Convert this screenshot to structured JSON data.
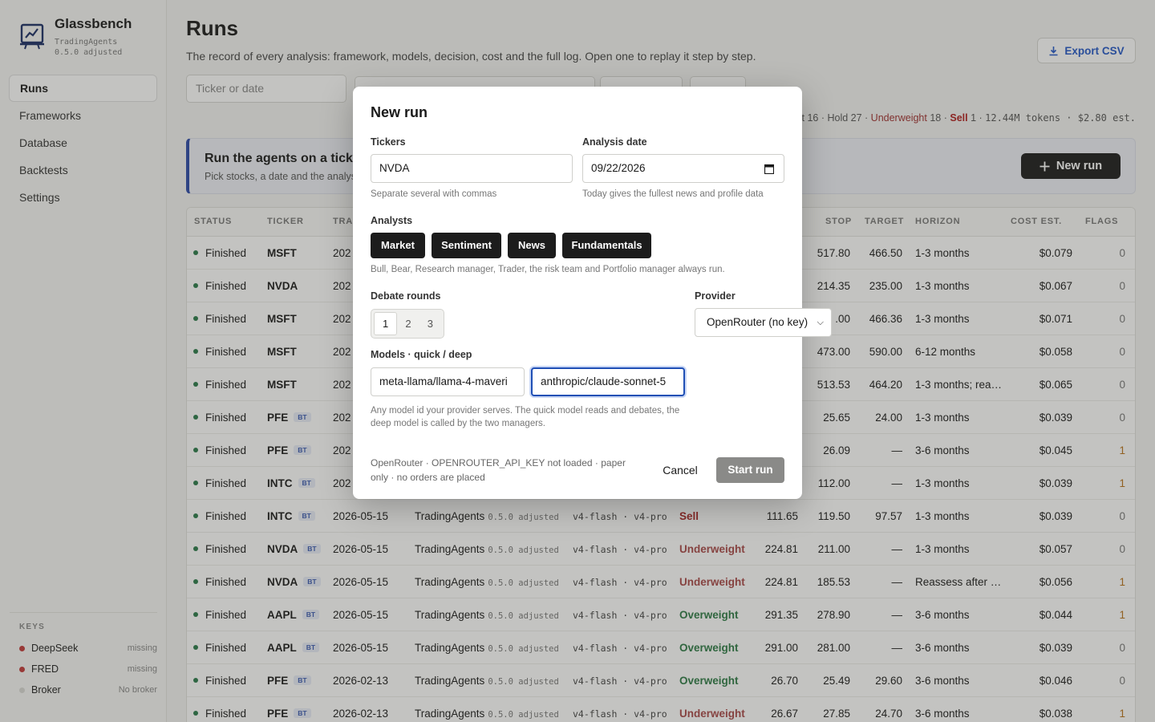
{
  "brand": {
    "name": "Glassbench",
    "sub1": "TradingAgents",
    "sub2": "0.5.0 adjusted"
  },
  "nav": {
    "items": [
      {
        "label": "Runs",
        "active": true
      },
      {
        "label": "Frameworks"
      },
      {
        "label": "Database"
      },
      {
        "label": "Backtests"
      },
      {
        "label": "Settings"
      }
    ]
  },
  "keys": {
    "title": "KEYS",
    "items": [
      {
        "label": "DeepSeek",
        "status": "missing",
        "color": "#c23a3a"
      },
      {
        "label": "FRED",
        "status": "missing",
        "color": "#c23a3a"
      },
      {
        "label": "Broker",
        "status": "No broker",
        "color": "#d8d8d4"
      }
    ]
  },
  "header": {
    "title": "Runs",
    "description": "The record of every analysis: framework, models, decision, cost and the full log. Open one to replay it step by step.",
    "export_label": "Export CSV"
  },
  "filters": {
    "ticker_placeholder": "Ticker or date"
  },
  "summary": {
    "pre": "ht 16 · Hold 27 · ",
    "underweight": "Underweight",
    "uw_count": " 18 · ",
    "sell": "Sell",
    "post": " 1 · ",
    "tokens": "12.44M tokens",
    "cost": " · $2.80 est."
  },
  "banner": {
    "title": "Run the agents on a ticker",
    "subtitle": "Pick stocks, a date and the analysts",
    "button_label": "New run"
  },
  "table": {
    "headers": {
      "status": "STATUS",
      "ticker": "TICKER",
      "trade": "TRA",
      "stop": "STOP",
      "target": "TARGET",
      "horizon": "HORIZON",
      "cost": "COST EST.",
      "flags": "FLAGS"
    },
    "rows": [
      {
        "status": "Finished",
        "ticker": "MSFT",
        "bt": false,
        "date": "202",
        "framework": "",
        "version": "",
        "models": "",
        "decision": "",
        "entry": "",
        "stop": "517.80",
        "target": "466.50",
        "horizon": "1-3 months",
        "cost": "$0.079",
        "flags": "0"
      },
      {
        "status": "Finished",
        "ticker": "NVDA",
        "bt": false,
        "date": "202",
        "framework": "",
        "version": "",
        "models": "",
        "decision": "",
        "entry": "",
        "stop": "214.35",
        "target": "235.00",
        "horizon": "1-3 months",
        "cost": "$0.067",
        "flags": "0"
      },
      {
        "status": "Finished",
        "ticker": "MSFT",
        "bt": false,
        "date": "202",
        "framework": "",
        "version": "",
        "models": "",
        "decision": "",
        "entry": "",
        "stop": ".00",
        "target": "466.36",
        "horizon": "1-3 months",
        "cost": "$0.071",
        "flags": "0"
      },
      {
        "status": "Finished",
        "ticker": "MSFT",
        "bt": false,
        "date": "202",
        "framework": "",
        "version": "",
        "models": "",
        "decision": "",
        "entry": "",
        "stop": "473.00",
        "target": "590.00",
        "horizon": "6-12 months",
        "cost": "$0.058",
        "flags": "0"
      },
      {
        "status": "Finished",
        "ticker": "MSFT",
        "bt": false,
        "date": "202",
        "framework": "",
        "version": "",
        "models": "",
        "decision": "",
        "entry": "",
        "stop": "513.53",
        "target": "464.20",
        "horizon": "1-3 months; rea…",
        "cost": "$0.065",
        "flags": "0"
      },
      {
        "status": "Finished",
        "ticker": "PFE",
        "bt": true,
        "date": "202",
        "framework": "",
        "version": "",
        "models": "",
        "decision": "",
        "entry": "",
        "stop": "25.65",
        "target": "24.00",
        "horizon": "1-3 months",
        "cost": "$0.039",
        "flags": "0"
      },
      {
        "status": "Finished",
        "ticker": "PFE",
        "bt": true,
        "date": "202",
        "framework": "",
        "version": "",
        "models": "",
        "decision": "",
        "entry": "",
        "stop": "26.09",
        "target": "—",
        "horizon": "3-6 months",
        "cost": "$0.045",
        "flags": "1"
      },
      {
        "status": "Finished",
        "ticker": "INTC",
        "bt": true,
        "date": "202",
        "framework": "",
        "version": "",
        "models": "",
        "decision": "",
        "entry": "",
        "stop": "112.00",
        "target": "—",
        "horizon": "1-3 months",
        "cost": "$0.039",
        "flags": "1"
      },
      {
        "status": "Finished",
        "ticker": "INTC",
        "bt": true,
        "date": "2026-05-15",
        "framework": "TradingAgents",
        "version": "0.5.0 adjusted",
        "models": "v4-flash · v4-pro",
        "decision": "Sell",
        "entry": "111.65",
        "stop": "119.50",
        "target": "97.57",
        "horizon": "1-3 months",
        "cost": "$0.039",
        "flags": "0"
      },
      {
        "status": "Finished",
        "ticker": "NVDA",
        "bt": true,
        "date": "2026-05-15",
        "framework": "TradingAgents",
        "version": "0.5.0 adjusted",
        "models": "v4-flash · v4-pro",
        "decision": "Underweight",
        "entry": "224.81",
        "stop": "211.00",
        "target": "—",
        "horizon": "1-3 months",
        "cost": "$0.057",
        "flags": "0"
      },
      {
        "status": "Finished",
        "ticker": "NVDA",
        "bt": true,
        "date": "2026-05-15",
        "framework": "TradingAgents",
        "version": "0.5.0 adjusted",
        "models": "v4-flash · v4-pro",
        "decision": "Underweight",
        "entry": "224.81",
        "stop": "185.53",
        "target": "—",
        "horizon": "Reassess after …",
        "cost": "$0.056",
        "flags": "1"
      },
      {
        "status": "Finished",
        "ticker": "AAPL",
        "bt": true,
        "date": "2026-05-15",
        "framework": "TradingAgents",
        "version": "0.5.0 adjusted",
        "models": "v4-flash · v4-pro",
        "decision": "Overweight",
        "entry": "291.35",
        "stop": "278.90",
        "target": "—",
        "horizon": "3-6 months",
        "cost": "$0.044",
        "flags": "1"
      },
      {
        "status": "Finished",
        "ticker": "AAPL",
        "bt": true,
        "date": "2026-05-15",
        "framework": "TradingAgents",
        "version": "0.5.0 adjusted",
        "models": "v4-flash · v4-pro",
        "decision": "Overweight",
        "entry": "291.00",
        "stop": "281.00",
        "target": "—",
        "horizon": "3-6 months",
        "cost": "$0.039",
        "flags": "0"
      },
      {
        "status": "Finished",
        "ticker": "PFE",
        "bt": true,
        "date": "2026-02-13",
        "framework": "TradingAgents",
        "version": "0.5.0 adjusted",
        "models": "v4-flash · v4-pro",
        "decision": "Overweight",
        "entry": "26.70",
        "stop": "25.49",
        "target": "29.60",
        "horizon": "3-6 months",
        "cost": "$0.046",
        "flags": "0"
      },
      {
        "status": "Finished",
        "ticker": "PFE",
        "bt": true,
        "date": "2026-02-13",
        "framework": "TradingAgents",
        "version": "0.5.0 adjusted",
        "models": "v4-flash · v4-pro",
        "decision": "Underweight",
        "entry": "26.67",
        "stop": "27.85",
        "target": "24.70",
        "horizon": "3-6 months",
        "cost": "$0.038",
        "flags": "1"
      }
    ]
  },
  "modal": {
    "title": "New run",
    "tickers_label": "Tickers",
    "tickers_value": "NVDA",
    "tickers_hint": "Separate several with commas",
    "date_label": "Analysis date",
    "date_value": "09/22/2026",
    "date_hint": "Today gives the fullest news and profile data",
    "analysts_label": "Analysts",
    "analysts": [
      "Market",
      "Sentiment",
      "News",
      "Fundamentals"
    ],
    "analysts_hint": "Bull, Bear, Research manager, Trader, the risk team and Portfolio manager always run.",
    "debate_label": "Debate rounds",
    "debate_options": [
      "1",
      "2",
      "3"
    ],
    "debate_selected": "1",
    "provider_label": "Provider",
    "provider_value": "OpenRouter (no key)",
    "models_label": "Models · quick / deep",
    "quick_model": "meta-llama/llama-4-maveri",
    "deep_model": "anthropic/claude-sonnet-5",
    "models_hint": "Any model id your provider serves. The quick model reads and debates, the deep model is called by the two managers.",
    "footer_note": "OpenRouter · OPENROUTER_API_KEY not loaded · paper only · no orders are placed",
    "cancel_label": "Cancel",
    "start_label": "Start run"
  }
}
